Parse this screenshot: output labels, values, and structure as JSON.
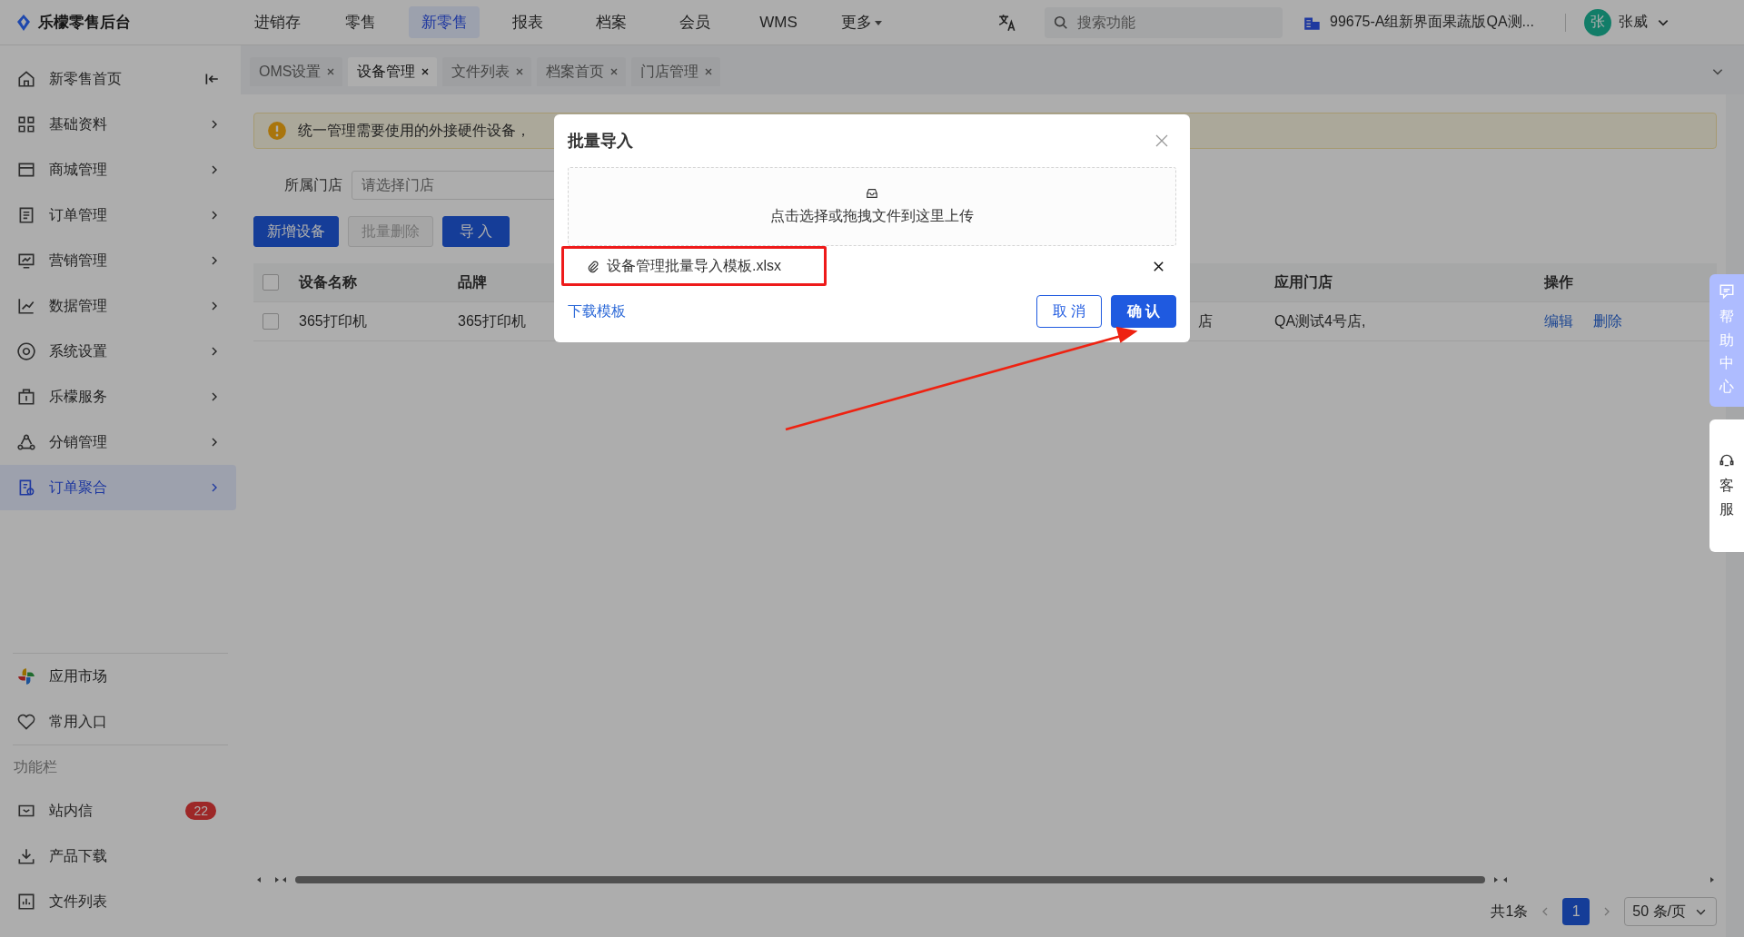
{
  "topbar": {
    "logo": "乐檬零售后台",
    "nav": [
      {
        "label": "进销存",
        "selected": false,
        "kind": "link"
      },
      {
        "label": "零售",
        "selected": false,
        "kind": "link"
      },
      {
        "label": "新零售",
        "selected": true,
        "kind": "link"
      },
      {
        "label": "报表",
        "selected": false,
        "kind": "link"
      },
      {
        "label": "档案",
        "selected": false,
        "kind": "link"
      },
      {
        "label": "会员",
        "selected": false,
        "kind": "link"
      },
      {
        "label": "WMS",
        "selected": false,
        "kind": "link"
      },
      {
        "label": "更多",
        "selected": false,
        "kind": "dropdown"
      }
    ],
    "search": {
      "placeholder": "搜索功能"
    },
    "store": "99675-A组新界面果蔬版QA测...",
    "user": {
      "avatar": "张",
      "name": "张威"
    }
  },
  "sidebar": {
    "items": [
      {
        "label": "新零售首页",
        "kind": "home",
        "selected": false
      },
      {
        "label": "基础资料",
        "kind": "group",
        "selected": false
      },
      {
        "label": "商城管理",
        "kind": "group",
        "selected": false
      },
      {
        "label": "订单管理",
        "kind": "group",
        "selected": false
      },
      {
        "label": "营销管理",
        "kind": "group",
        "selected": false
      },
      {
        "label": "数据管理",
        "kind": "group",
        "selected": false
      },
      {
        "label": "系统设置",
        "kind": "group",
        "selected": false
      },
      {
        "label": "乐檬服务",
        "kind": "group",
        "selected": false
      },
      {
        "label": "分销管理",
        "kind": "group",
        "selected": false
      },
      {
        "label": "订单聚合",
        "kind": "group",
        "selected": true
      }
    ],
    "shortcuts": [
      {
        "label": "应用市场"
      },
      {
        "label": "常用入口"
      }
    ],
    "section_label": "功能栏",
    "tools": [
      {
        "label": "站内信",
        "badge": "22"
      },
      {
        "label": "产品下载"
      },
      {
        "label": "文件列表"
      }
    ]
  },
  "tabs": [
    {
      "label": "OMS设置",
      "selected": false
    },
    {
      "label": "设备管理",
      "selected": true
    },
    {
      "label": "文件列表",
      "selected": false
    },
    {
      "label": "档案首页",
      "selected": false
    },
    {
      "label": "门店管理",
      "selected": false
    }
  ],
  "alert": "统一管理需要使用的外接硬件设备，",
  "filter": {
    "label": "所属门店",
    "placeholder": "请选择门店"
  },
  "toolbar": [
    {
      "label": "新增设备",
      "disabled": false
    },
    {
      "label": "批量删除",
      "disabled": true
    },
    {
      "label": "导 入",
      "disabled": false
    }
  ],
  "table": {
    "all_selected": false,
    "columns": {
      "device_name": "设备名称",
      "brand": "品牌",
      "store": "应用门店",
      "actions": "操作"
    },
    "rows": [
      {
        "selected": false,
        "device_name": "365打印机",
        "brand": "365打印机",
        "column_3": "店",
        "store": "QA测试4号店,",
        "actions": [
          "编辑",
          "删除"
        ]
      }
    ]
  },
  "pagination": {
    "total": "共1条",
    "pages": [
      {
        "label": "1",
        "selected": true
      }
    ],
    "page_size": "50 条/页"
  },
  "dialog": {
    "title": "批量导入",
    "upload_hint": "点击选择或拖拽文件到这里上传",
    "file": "设备管理批量导入模板.xlsx",
    "download_link": "下载模板",
    "buttons": [
      {
        "label": "取 消",
        "kind": "secondary"
      },
      {
        "label": "确 认",
        "kind": "primary"
      }
    ]
  },
  "float_tabs": [
    {
      "label": "帮助中心",
      "kind": "help"
    },
    {
      "label": "客服",
      "kind": "service"
    }
  ]
}
